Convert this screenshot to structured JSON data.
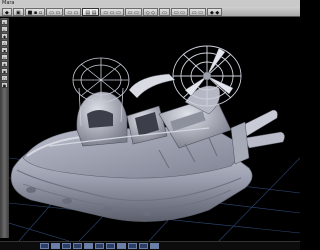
{
  "menubar": {
    "items": [
      "Mara"
    ]
  },
  "toolbar": {
    "buttons": [
      {
        "label": "◆",
        "active": false
      },
      {
        "label": "▣",
        "active": false
      },
      {
        "label": "■ ▪ ▫",
        "active": false
      },
      {
        "label": "▭ ▭",
        "active": false
      },
      {
        "label": "▭ ▭",
        "active": false
      },
      {
        "label": "▤ ▤",
        "active": true
      },
      {
        "label": "▭ ▭ ▭",
        "active": false
      },
      {
        "label": "▭ ▭",
        "active": false
      },
      {
        "label": "◇ ◇",
        "active": false
      },
      {
        "label": "▭",
        "active": false
      },
      {
        "label": "▭ ▭",
        "active": false
      },
      {
        "label": "▭ ▭",
        "active": false
      },
      {
        "label": "◆ ◆",
        "active": false
      }
    ]
  },
  "sidebar": {
    "tools": [
      "▸",
      "▹",
      "◆",
      "◇",
      "▪",
      "▫",
      "◈",
      "◉",
      "○",
      "●"
    ]
  },
  "statusbar": {
    "indicators": 11
  },
  "colors": {
    "grid": "#2f4a78",
    "model": "#9fa3b3"
  }
}
